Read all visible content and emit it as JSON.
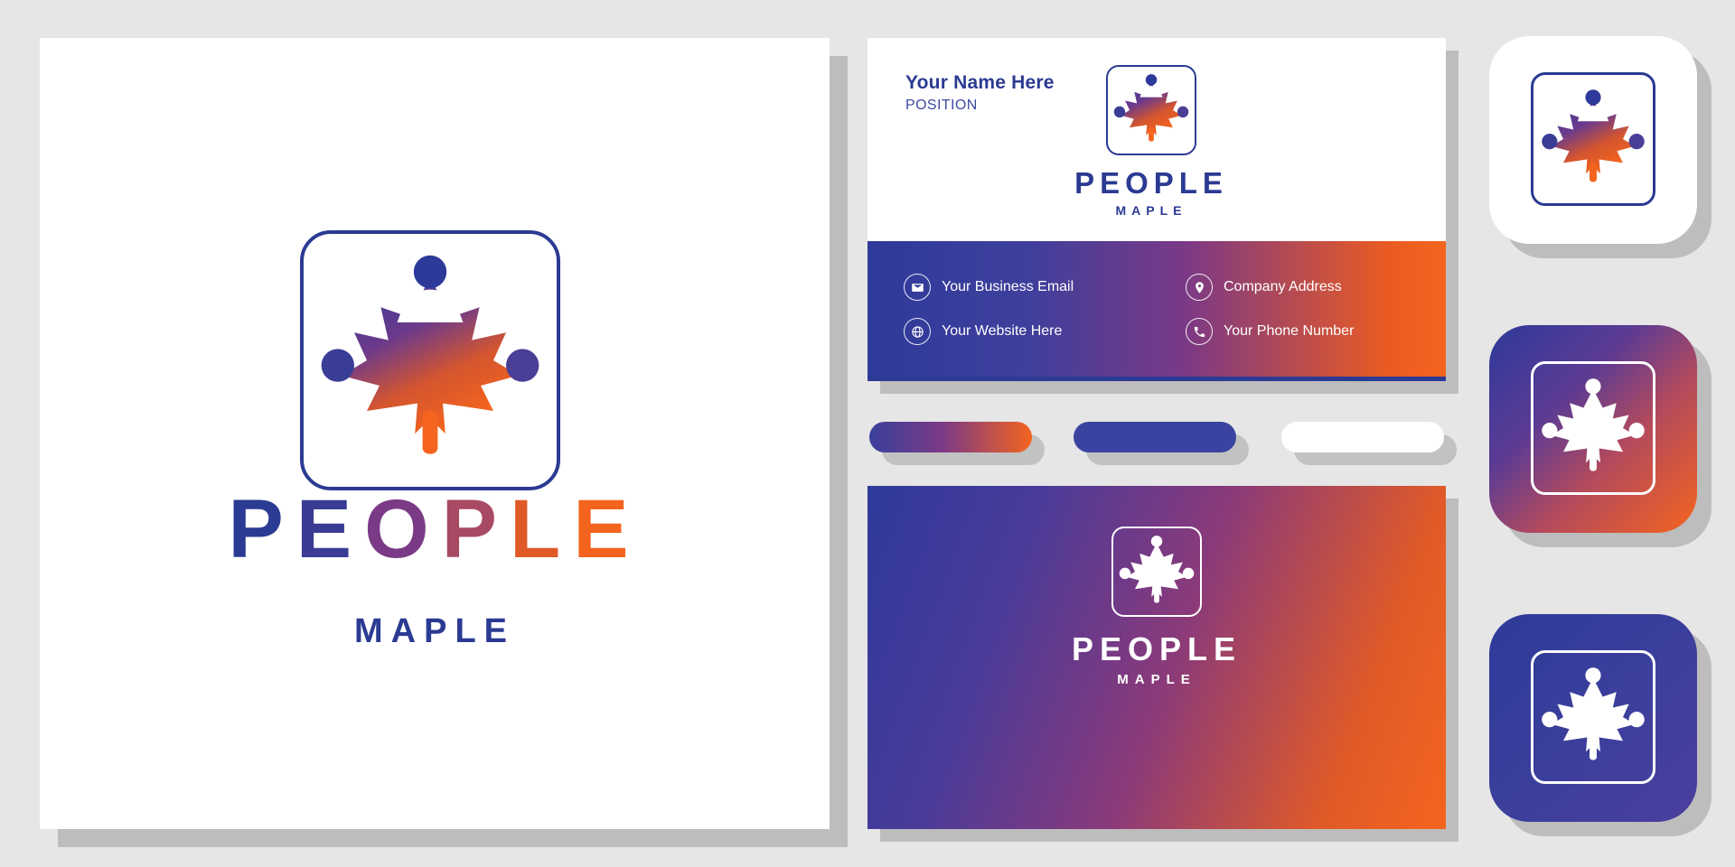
{
  "brand": {
    "name_part1": "PEOP",
    "name_part2": "LE",
    "name_full": "PEOPLE",
    "tagline": "MAPLE",
    "colors": {
      "blue": "#2b3a92",
      "purple": "#7b3a86",
      "orange": "#f4641e",
      "white": "#ffffff",
      "background": "#e6e6e6",
      "shadow": "#bdbdbd"
    }
  },
  "wordmark": {
    "letters": [
      {
        "char": "P",
        "color": "#2b3a92"
      },
      {
        "char": "E",
        "color": "#3a3c94"
      },
      {
        "char": "O",
        "color": "#7b3a86"
      },
      {
        "char": "P",
        "color": "#a84a63"
      },
      {
        "char": "L",
        "color": "#e05a28"
      },
      {
        "char": "E",
        "color": "#f4641e"
      }
    ],
    "tagline": "MAPLE"
  },
  "business_card": {
    "name": "Your Name Here",
    "position": "POSITION",
    "logo_title": "PEOPLE",
    "logo_subtitle": "MAPLE",
    "contacts": [
      {
        "icon": "envelope-icon",
        "label": "Your Business Email"
      },
      {
        "icon": "map-pin-icon",
        "label": "Company Address"
      },
      {
        "icon": "globe-icon",
        "label": "Your Website Here"
      },
      {
        "icon": "phone-icon",
        "label": "Your Phone Number"
      }
    ]
  },
  "card_back": {
    "logo_title": "PEOPLE",
    "logo_subtitle": "MAPLE"
  },
  "swatches": [
    {
      "name": "gradient-pill",
      "fill": "gradient"
    },
    {
      "name": "blue-pill",
      "fill": "#3a44a0"
    },
    {
      "name": "white-pill",
      "fill": "#ffffff"
    }
  ],
  "app_icons": [
    {
      "name": "app-icon-white",
      "style": "white-background-gradient-leaf"
    },
    {
      "name": "app-icon-gradient",
      "style": "gradient-background-white-leaf"
    },
    {
      "name": "app-icon-blue",
      "style": "blue-background-white-leaf"
    }
  ]
}
